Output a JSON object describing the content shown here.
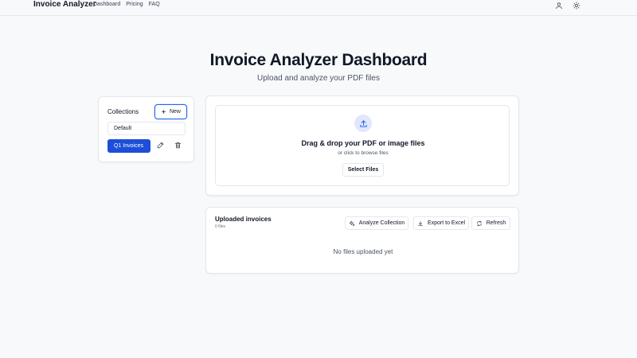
{
  "header": {
    "brand": "Invoice Analyzer",
    "nav": [
      "Dashboard",
      "Pricing",
      "FAQ"
    ],
    "icons": [
      "user-icon",
      "sun-icon"
    ]
  },
  "hero": {
    "title": "Invoice Analyzer Dashboard",
    "subtitle": "Upload and analyze your PDF files"
  },
  "collections": {
    "title": "Collections",
    "new_label": "New",
    "items": [
      {
        "label": "Default",
        "active": false
      },
      {
        "label": "Q1 Invoices",
        "active": true
      }
    ]
  },
  "upload": {
    "title": "Drag & drop your PDF or image files",
    "subtitle": "or click to browse files",
    "button": "Select Files"
  },
  "invoices": {
    "title": "Uploaded invoices",
    "count": "0 files",
    "actions": {
      "analyze": "Analyze Collection",
      "export": "Export to Excel",
      "refresh": "Refresh"
    },
    "empty": "No files uploaded yet"
  },
  "colors": {
    "accent": "#2563eb",
    "active_item": "#1d4ed8",
    "background": "#f8f9fb"
  }
}
